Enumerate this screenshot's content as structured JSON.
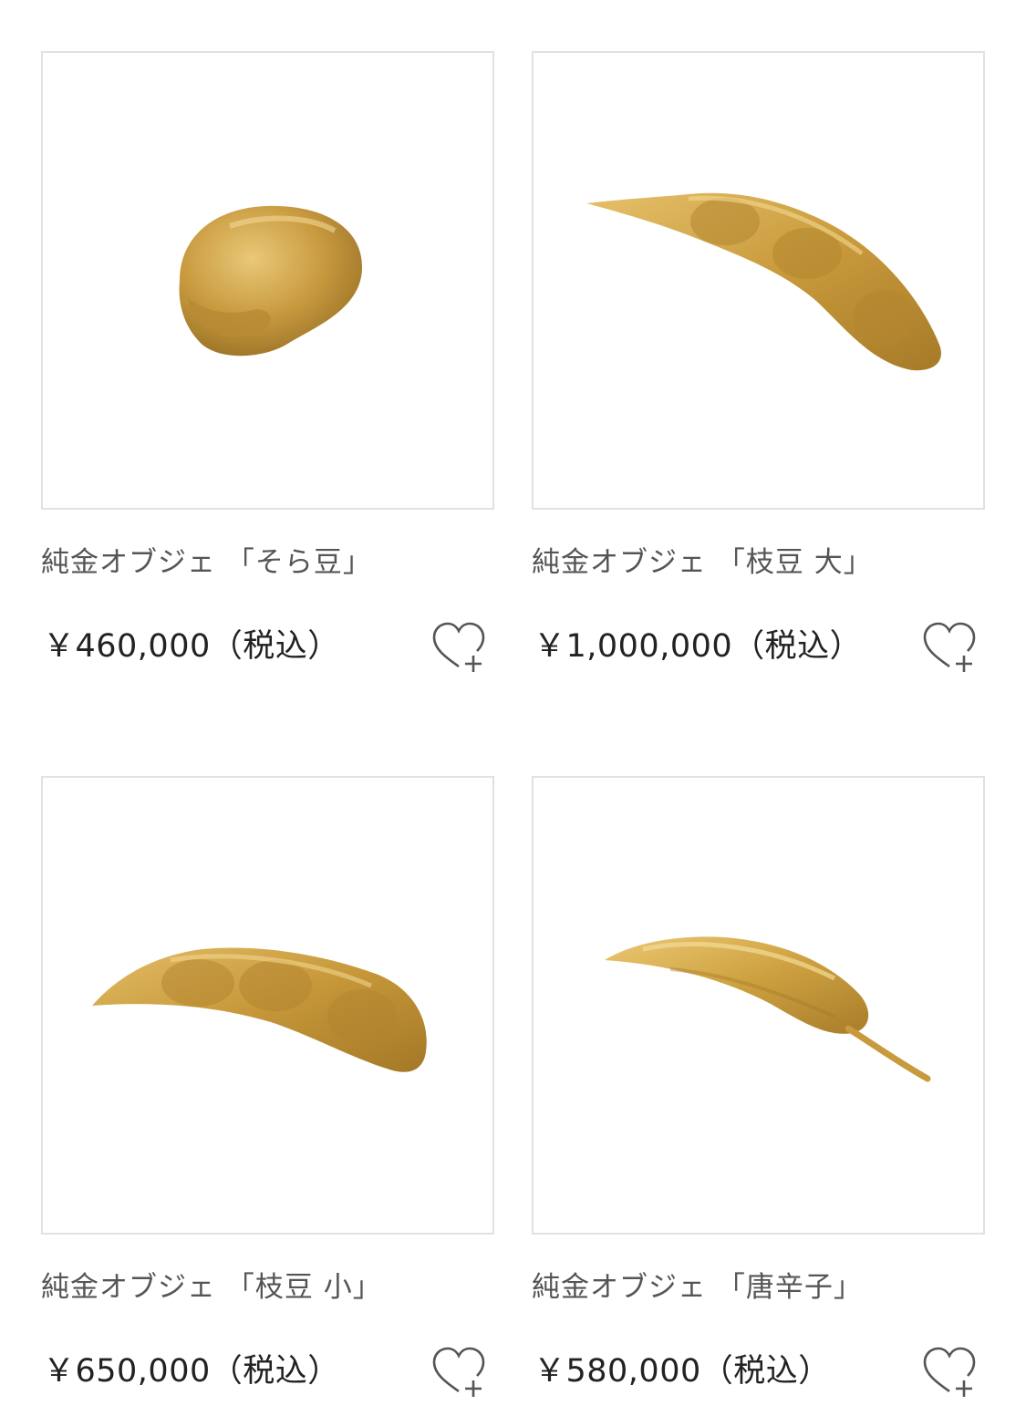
{
  "products": [
    {
      "name": "純金オブジェ 「そら豆」",
      "price": "￥460,000（税込）",
      "image_icon": "gold-broad-bean-image",
      "favorite_icon": "heart-plus-icon"
    },
    {
      "name": "純金オブジェ 「枝豆 大」",
      "price": "￥1,000,000（税込）",
      "image_icon": "gold-edamame-large-image",
      "favorite_icon": "heart-plus-icon"
    },
    {
      "name": "純金オブジェ 「枝豆 小」",
      "price": "￥650,000（税込）",
      "image_icon": "gold-edamame-small-image",
      "favorite_icon": "heart-plus-icon"
    },
    {
      "name": "純金オブジェ 「唐辛子」",
      "price": "￥580,000（税込）",
      "image_icon": "gold-chili-pepper-image",
      "favorite_icon": "heart-plus-icon"
    }
  ],
  "colors": {
    "gold": "#c79b3d",
    "border": "#e1e1e1",
    "text": "#222222",
    "title_text": "#555555"
  }
}
